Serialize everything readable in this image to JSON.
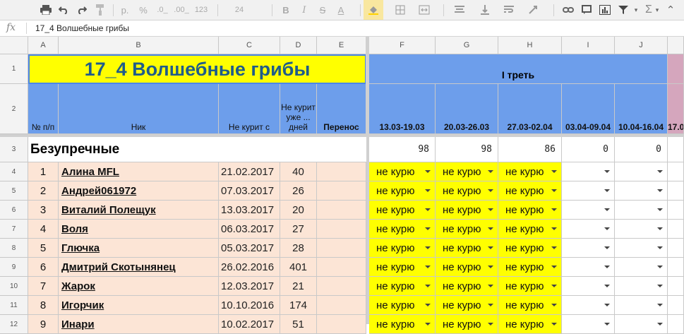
{
  "toolbar": {
    "zoom_pct": "p.",
    "percent": "%",
    "dec_less": ".0_",
    "dec_more": ".00_",
    "format": "123",
    "font_size": "24",
    "bold": "B",
    "strike": "S",
    "text_color": "A"
  },
  "formula_bar": {
    "fx": "fx",
    "value": "17_4 Волшебные грибы"
  },
  "columns": [
    "A",
    "B",
    "C",
    "D",
    "E",
    "F",
    "G",
    "H",
    "I",
    "J"
  ],
  "rows": [
    "1",
    "2",
    "3",
    "4",
    "5",
    "6",
    "7",
    "8",
    "9",
    "10",
    "11",
    "12"
  ],
  "title": "17_4 Волшебные грибы",
  "third_label": "I треть",
  "headers": {
    "num": "№ п/п",
    "nick": "Ник",
    "since": "Не курит с",
    "days": "Не курит уже ... дней",
    "transfer": "Перенос",
    "weeks": [
      "13.03-19.03",
      "20.03-26.03",
      "27.03-02.04",
      "03.04-09.04",
      "10.04-16.04",
      "17.0"
    ]
  },
  "section": {
    "label": "Безупречные",
    "scores": [
      "98",
      "98",
      "86",
      "0",
      "0"
    ]
  },
  "participants": [
    {
      "n": "1",
      "nick": "Алина MFL",
      "since": "21.02.2017",
      "days": "40",
      "weeks": [
        "не курю",
        "не курю",
        "не курю",
        "",
        ""
      ]
    },
    {
      "n": "2",
      "nick": "Андрей061972",
      "since": "07.03.2017",
      "days": "26",
      "weeks": [
        "не курю",
        "не курю",
        "не курю",
        "",
        ""
      ]
    },
    {
      "n": "3",
      "nick": "Виталий Полещук",
      "since": "13.03.2017",
      "days": "20",
      "weeks": [
        "не курю",
        "не курю",
        "не курю",
        "",
        ""
      ]
    },
    {
      "n": "4",
      "nick": "Воля",
      "since": "06.03.2017",
      "days": "27",
      "weeks": [
        "не курю",
        "не курю",
        "не курю",
        "",
        ""
      ]
    },
    {
      "n": "5",
      "nick": "Глючка",
      "since": "05.03.2017",
      "days": "28",
      "weeks": [
        "не курю",
        "не курю",
        "не курю",
        "",
        ""
      ]
    },
    {
      "n": "6",
      "nick": "Дмитрий Скотынянец",
      "since": "26.02.2016",
      "days": "401",
      "weeks": [
        "не курю",
        "не курю",
        "не курю",
        "",
        ""
      ]
    },
    {
      "n": "7",
      "nick": "Жарок",
      "since": "12.03.2017",
      "days": "21",
      "weeks": [
        "не курю",
        "не курю",
        "не курю",
        "",
        ""
      ]
    },
    {
      "n": "8",
      "nick": "Игорчик",
      "since": "10.10.2016",
      "days": "174",
      "weeks": [
        "не курю",
        "не курю",
        "не курю",
        "",
        ""
      ]
    },
    {
      "n": "9",
      "nick": "Инари",
      "since": "10.02.2017",
      "days": "51",
      "weeks": [
        "не курю",
        "не курю",
        "не курю",
        "",
        ""
      ]
    }
  ]
}
